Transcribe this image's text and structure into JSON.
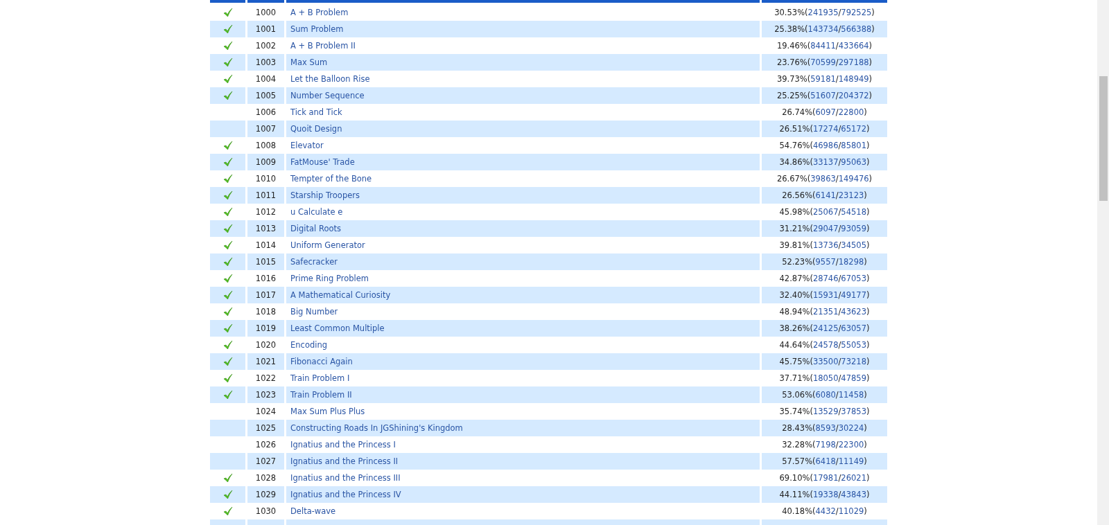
{
  "problems": [
    {
      "solved": true,
      "id": "1000",
      "title": "A + B Problem",
      "ratio": "30.53%(241935/792525)"
    },
    {
      "solved": true,
      "id": "1001",
      "title": "Sum Problem",
      "ratio": "25.38%(143734/566388)"
    },
    {
      "solved": true,
      "id": "1002",
      "title": "A + B Problem II",
      "ratio": "19.46%(84411/433664)"
    },
    {
      "solved": true,
      "id": "1003",
      "title": "Max Sum",
      "ratio": "23.76%(70599/297188)"
    },
    {
      "solved": true,
      "id": "1004",
      "title": "Let the Balloon Rise",
      "ratio": "39.73%(59181/148949)"
    },
    {
      "solved": true,
      "id": "1005",
      "title": "Number Sequence",
      "ratio": "25.25%(51607/204372)"
    },
    {
      "solved": false,
      "id": "1006",
      "title": "Tick and Tick",
      "ratio": "26.74%(6097/22800)"
    },
    {
      "solved": false,
      "id": "1007",
      "title": "Quoit Design",
      "ratio": "26.51%(17274/65172)"
    },
    {
      "solved": true,
      "id": "1008",
      "title": "Elevator",
      "ratio": "54.76%(46986/85801)"
    },
    {
      "solved": true,
      "id": "1009",
      "title": "FatMouse' Trade",
      "ratio": "34.86%(33137/95063)"
    },
    {
      "solved": true,
      "id": "1010",
      "title": "Tempter of the Bone",
      "ratio": "26.67%(39863/149476)"
    },
    {
      "solved": true,
      "id": "1011",
      "title": "Starship Troopers",
      "ratio": "26.56%(6141/23123)"
    },
    {
      "solved": true,
      "id": "1012",
      "title": "u Calculate e",
      "ratio": "45.98%(25067/54518)"
    },
    {
      "solved": true,
      "id": "1013",
      "title": "Digital Roots",
      "ratio": "31.21%(29047/93059)"
    },
    {
      "solved": true,
      "id": "1014",
      "title": "Uniform Generator",
      "ratio": "39.81%(13736/34505)"
    },
    {
      "solved": true,
      "id": "1015",
      "title": "Safecracker",
      "ratio": "52.23%(9557/18298)"
    },
    {
      "solved": true,
      "id": "1016",
      "title": "Prime Ring Problem",
      "ratio": "42.87%(28746/67053)"
    },
    {
      "solved": true,
      "id": "1017",
      "title": "A Mathematical Curiosity",
      "ratio": "32.40%(15931/49177)"
    },
    {
      "solved": true,
      "id": "1018",
      "title": "Big Number",
      "ratio": "48.94%(21351/43623)"
    },
    {
      "solved": true,
      "id": "1019",
      "title": "Least Common Multiple",
      "ratio": "38.26%(24125/63057)"
    },
    {
      "solved": true,
      "id": "1020",
      "title": "Encoding",
      "ratio": "44.64%(24578/55053)"
    },
    {
      "solved": true,
      "id": "1021",
      "title": "Fibonacci Again",
      "ratio": "45.75%(33500/73218)"
    },
    {
      "solved": true,
      "id": "1022",
      "title": "Train Problem I",
      "ratio": "37.71%(18050/47859)"
    },
    {
      "solved": true,
      "id": "1023",
      "title": "Train Problem II",
      "ratio": "53.06%(6080/11458)"
    },
    {
      "solved": false,
      "id": "1024",
      "title": "Max Sum Plus Plus",
      "ratio": "35.74%(13529/37853)"
    },
    {
      "solved": false,
      "id": "1025",
      "title": "Constructing Roads In JGShining's Kingdom",
      "ratio": "28.43%(8593/30224)"
    },
    {
      "solved": false,
      "id": "1026",
      "title": "Ignatius and the Princess I",
      "ratio": "32.28%(7198/22300)"
    },
    {
      "solved": false,
      "id": "1027",
      "title": "Ignatius and the Princess II",
      "ratio": "57.57%(6418/11149)"
    },
    {
      "solved": true,
      "id": "1028",
      "title": "Ignatius and the Princess III",
      "ratio": "69.10%(17981/26021)"
    },
    {
      "solved": true,
      "id": "1029",
      "title": "Ignatius and the Princess IV",
      "ratio": "44.11%(19338/43843)"
    },
    {
      "solved": true,
      "id": "1030",
      "title": "Delta-wave",
      "ratio": "40.18%(4432/11029)"
    }
  ]
}
